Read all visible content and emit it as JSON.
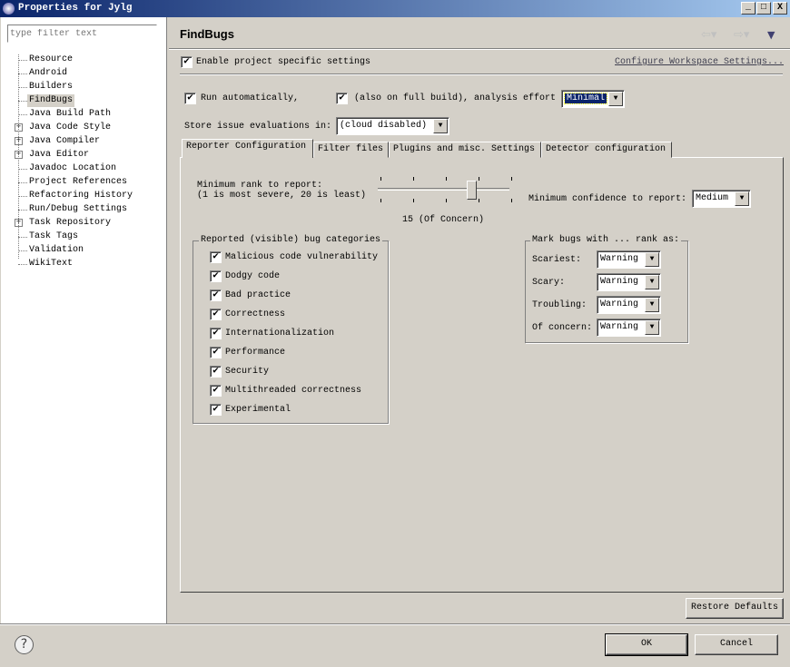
{
  "window": {
    "title": "Properties for Jylg",
    "minimize": "_",
    "maximize": "□",
    "close": "X"
  },
  "sidebar": {
    "filter_placeholder": "type filter text",
    "items": [
      {
        "label": "Resource",
        "expandable": false
      },
      {
        "label": "Android",
        "expandable": false
      },
      {
        "label": "Builders",
        "expandable": false
      },
      {
        "label": "FindBugs",
        "expandable": false,
        "selected": true
      },
      {
        "label": "Java Build Path",
        "expandable": false
      },
      {
        "label": "Java Code Style",
        "expandable": true
      },
      {
        "label": "Java Compiler",
        "expandable": true
      },
      {
        "label": "Java Editor",
        "expandable": true
      },
      {
        "label": "Javadoc Location",
        "expandable": false
      },
      {
        "label": "Project References",
        "expandable": false
      },
      {
        "label": "Refactoring History",
        "expandable": false
      },
      {
        "label": "Run/Debug Settings",
        "expandable": false
      },
      {
        "label": "Task Repository",
        "expandable": true
      },
      {
        "label": "Task Tags",
        "expandable": false
      },
      {
        "label": "Validation",
        "expandable": false
      },
      {
        "label": "WikiText",
        "expandable": false
      }
    ]
  },
  "page": {
    "title": "FindBugs",
    "enable_project": "Enable project specific settings",
    "configure_link": "Configure Workspace Settings...",
    "run_auto": "Run automatically,",
    "full_build": "(also on full build),",
    "effort_label": "analysis effort",
    "effort_value": "Minimal",
    "store_label": "Store issue evaluations in:",
    "store_value": "(cloud disabled)"
  },
  "tabs": [
    "Reporter Configuration",
    "Filter files",
    "Plugins and misc. Settings",
    "Detector configuration"
  ],
  "reporter": {
    "rank_label1": "Minimum rank to report:",
    "rank_label2": "(1 is most severe, 20 is least)",
    "rank_value": 15,
    "rank_min": 1,
    "rank_max": 20,
    "rank_text": "15 (Of Concern)",
    "confidence_label": "Minimum confidence to report:",
    "confidence_value": "Medium",
    "categories_title": "Reported (visible) bug categories",
    "categories": [
      "Malicious code vulnerability",
      "Dodgy code",
      "Bad practice",
      "Correctness",
      "Internationalization",
      "Performance",
      "Security",
      "Multithreaded correctness",
      "Experimental"
    ],
    "mark_title": "Mark bugs with ... rank as:",
    "marks": [
      {
        "label": "Scariest:",
        "value": "Warning"
      },
      {
        "label": "Scary:",
        "value": "Warning"
      },
      {
        "label": "Troubling:",
        "value": "Warning"
      },
      {
        "label": "Of concern:",
        "value": "Warning"
      }
    ]
  },
  "buttons": {
    "restore": "Restore Defaults",
    "ok": "OK",
    "cancel": "Cancel",
    "help": "?"
  }
}
